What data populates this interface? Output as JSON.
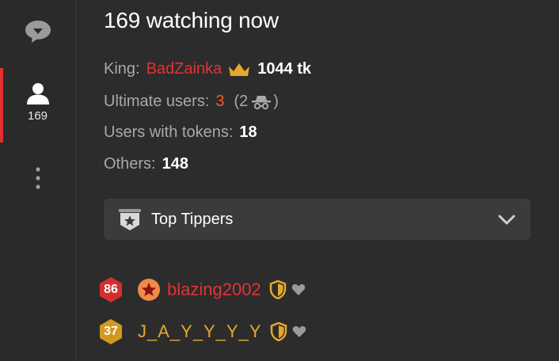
{
  "sidebar": {
    "chat_icon": "chat-bubble-icon",
    "users_icon": "user-icon",
    "users_count": "169",
    "more_icon": "more-vertical-icon"
  },
  "panel": {
    "title": "169 watching now",
    "king": {
      "label": "King:",
      "name": "BadZainka",
      "icon": "crown-icon",
      "amount": "1044 tk"
    },
    "ultimate": {
      "label": "Ultimate users:",
      "count": "3",
      "anon_open": "(2",
      "anon_icon": "incognito-icon",
      "anon_close": ")"
    },
    "tokens": {
      "label": "Users with tokens:",
      "count": "18"
    },
    "others": {
      "label": "Others:",
      "count": "148"
    }
  },
  "dropdown": {
    "icon": "star-badge-icon",
    "label": "Top Tippers",
    "chevron": "chevron-down-icon"
  },
  "tippers": [
    {
      "level": "86",
      "name": "blazing2002",
      "has_star": true
    },
    {
      "level": "37",
      "name": "J_A_Y_Y_Y_Y",
      "has_star": false
    }
  ],
  "colors": {
    "accent_red": "#e33232",
    "ultimate_orange": "#f05a24",
    "gold": "#e8a82d",
    "background": "#2c2c2c"
  }
}
